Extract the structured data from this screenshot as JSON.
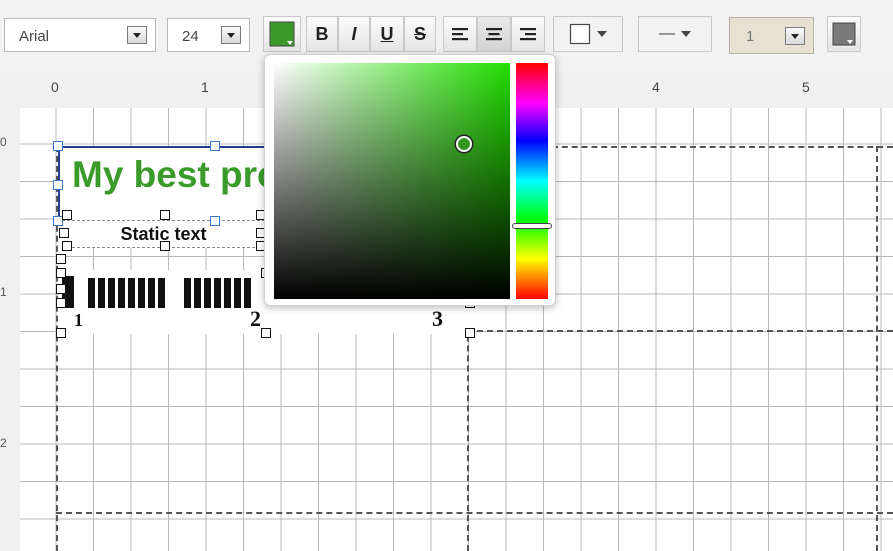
{
  "toolbar": {
    "font_family": "Arial",
    "font_size": "24",
    "text_color": "#3a9b2b",
    "bold_label": "B",
    "italic_label": "I",
    "underline_label": "U",
    "strike_label": "S",
    "alignment": "center",
    "border_icon": "square-outline-icon",
    "line_style_label": "—",
    "line_width": "1"
  },
  "ruler": {
    "top_labels": [
      "0",
      "1",
      "4",
      "5"
    ],
    "left_labels": [
      "0",
      "1",
      "2"
    ]
  },
  "report": {
    "title_text": "My best pro",
    "static_text": "Static text",
    "barcode_digits": [
      "1",
      "2",
      "3"
    ]
  },
  "color_picker": {
    "hue_color": "#22dd00",
    "selected_color": "#3a9b2b"
  }
}
